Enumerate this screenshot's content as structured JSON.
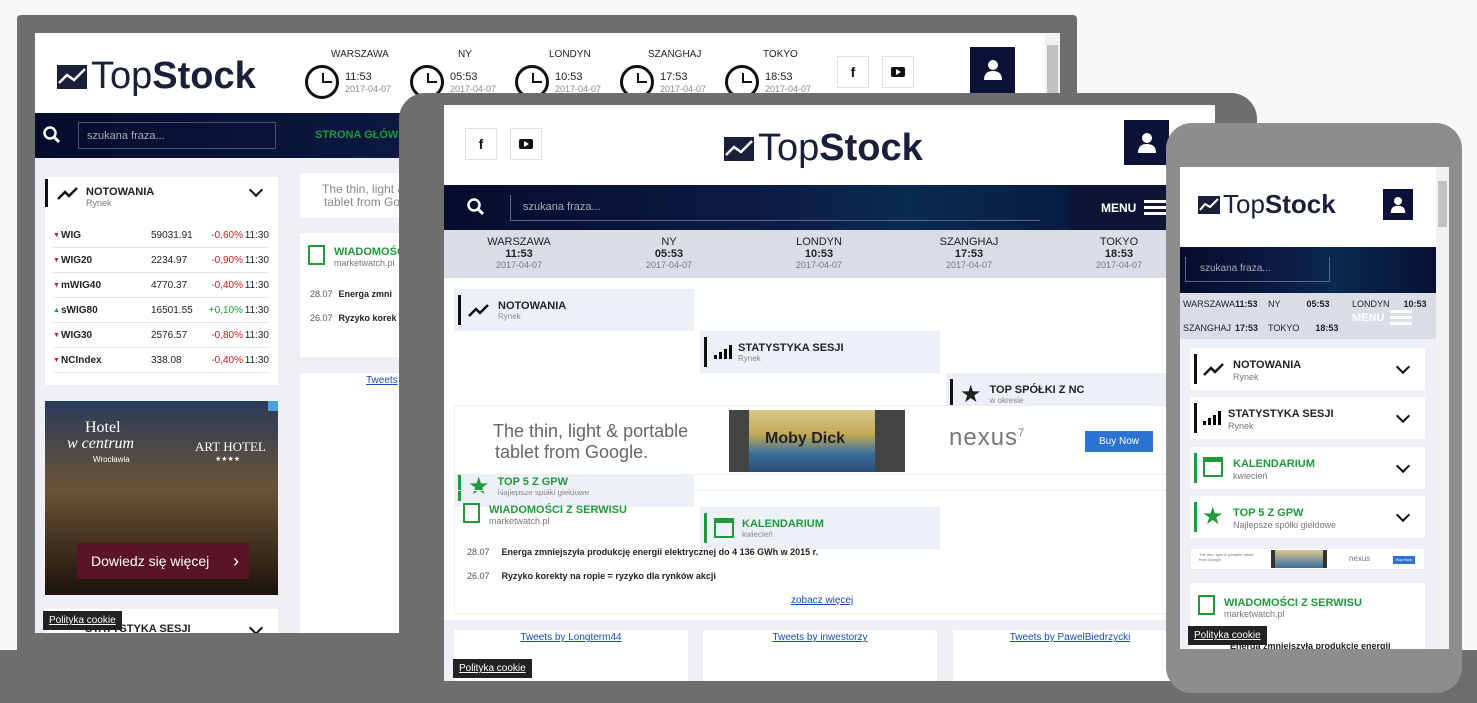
{
  "brand": {
    "part1": "Top",
    "part2": "Stock"
  },
  "desktop": {
    "clocks": [
      {
        "city": "WARSZAWA",
        "time": "11:53",
        "date": "2017-04-07"
      },
      {
        "city": "NY",
        "time": "05:53",
        "date": "2017-04-07"
      },
      {
        "city": "LONDYN",
        "time": "10:53",
        "date": "2017-04-07"
      },
      {
        "city": "SZANGHAJ",
        "time": "17:53",
        "date": "2017-04-07"
      },
      {
        "city": "TOKYO",
        "time": "18:53",
        "date": "2017-04-07"
      }
    ],
    "search_placeholder": "szukana fraza...",
    "nav_home": "STRONA GŁÓWN",
    "quotes_title": "NOTOWANIA",
    "quotes_sub": "Rynek",
    "quotes": [
      {
        "name": "WIG",
        "value": "59031.91",
        "change": "-0,60%",
        "time": "11:30",
        "dir": "down"
      },
      {
        "name": "WIG20",
        "value": "2234.97",
        "change": "-0,90%",
        "time": "11:30",
        "dir": "down"
      },
      {
        "name": "mWIG40",
        "value": "4770.37",
        "change": "-0,40%",
        "time": "11:30",
        "dir": "down"
      },
      {
        "name": "sWIG80",
        "value": "16501.55",
        "change": "+0,10%",
        "time": "11:30",
        "dir": "up"
      },
      {
        "name": "WIG30",
        "value": "2576.57",
        "change": "-0,80%",
        "time": "11:30",
        "dir": "down"
      },
      {
        "name": "NCIndex",
        "value": "338.08",
        "change": "-0,40%",
        "time": "11:30",
        "dir": "down"
      }
    ],
    "ad_line1": "The thin, light &",
    "ad_line2": "tablet from Goo",
    "news_title": "WIADOMOŚCI",
    "news_source": "marketwatch.pl",
    "news": [
      {
        "date": "28.07",
        "text": "Energa zmni"
      },
      {
        "date": "26.07",
        "text": "Ryzyko korek"
      }
    ],
    "tweets_link": "Tweets",
    "hotel_ad": {
      "brand1": "Hotel",
      "brand2": "w centrum",
      "city": "Wrocławia",
      "brand3": "ART HOTEL",
      "stars": "★★★★",
      "cta": "Dowiedz się więcej"
    },
    "bottom_tile": "STATYSTYKA SESJI",
    "cookie": "Polityka cookie"
  },
  "tablet": {
    "search_placeholder": "szukana fraza...",
    "menu_label": "MENU",
    "clocks": [
      {
        "city": "WARSZAWA",
        "time": "11:53",
        "date": "2017-04-07"
      },
      {
        "city": "NY",
        "time": "05:53",
        "date": "2017-04-07"
      },
      {
        "city": "LONDYN",
        "time": "10:53",
        "date": "2017-04-07"
      },
      {
        "city": "SZANGHAJ",
        "time": "17:53",
        "date": "2017-04-07"
      },
      {
        "city": "TOKYO",
        "time": "18:53",
        "date": "2017-04-07"
      }
    ],
    "tiles": [
      {
        "title": "NOTOWANIA",
        "sub": "Rynek"
      },
      {
        "title": "STATYSTYKA SESJI",
        "sub": "Rynek"
      },
      {
        "title": "TOP SPÓŁKI Z NC",
        "sub": "w okresie"
      },
      {
        "title": "TOP 5 Z GPW",
        "sub": "Najlepsze spółki giełdowe"
      },
      {
        "title": "KALENDARIUM",
        "sub": "kwiecień"
      }
    ],
    "ad": {
      "line1": "The thin, light & portable",
      "line2": "tablet from Google.",
      "book": "Moby Dick",
      "product": "nexus",
      "sup": "7",
      "cta": "Buy Now"
    },
    "news_title": "WIADOMOŚCI Z SERWISU",
    "news_source": "marketwatch.pl",
    "news": [
      {
        "date": "28.07",
        "text": "Energa zmniejszyła produkcję energii elektrycznej do 4 136 GWh w 2015 r."
      },
      {
        "date": "26.07",
        "text": "Ryzyko korekty na ropie = ryzyko dla rynków akcji"
      }
    ],
    "see_more": "zobacz więcej",
    "tweets": [
      "Tweets by Longterm44",
      "Tweets by inwestorzy",
      "Tweets by PawelBiedrzycki"
    ],
    "cookie": "Polityka cookie"
  },
  "phone": {
    "search_placeholder": "szukana fraza...",
    "clocks_row1": [
      {
        "city": "WARSZAWA",
        "time": "11:53"
      },
      {
        "city": "NY",
        "time": "05:53"
      },
      {
        "city": "LONDYN",
        "time": "10:53"
      }
    ],
    "clocks_row2": [
      {
        "city": "SZANGHAJ",
        "time": "17:53"
      },
      {
        "city": "TOKYO",
        "time": "18:53"
      }
    ],
    "menu_label": "MENU",
    "tiles": [
      {
        "title": "NOTOWANIA",
        "sub": "Rynek"
      },
      {
        "title": "STATYSTYKA SESJI",
        "sub": "Rynek"
      },
      {
        "title": "KALENDARIUM",
        "sub": "kwiecień"
      },
      {
        "title": "TOP 5 Z GPW",
        "sub": "Najlepsze spółki giełdowe"
      }
    ],
    "ad_text": "The thin, light & portable tablet from Google.",
    "ad_product": "nexus",
    "ad_cta": "Buy Now",
    "news_title": "WIADOMOŚCI Z SERWISU",
    "news_source": "marketwatch.pl",
    "news_text": "Energa zmniejszyła produkcję energii",
    "cookie": "Polityka cookie"
  },
  "colors": {
    "navy": "#0b1237",
    "green": "#1e9a3a",
    "red": "#cc1b1b",
    "frame": "#6e6e6e",
    "phone_frame": "#8d8d8d"
  }
}
